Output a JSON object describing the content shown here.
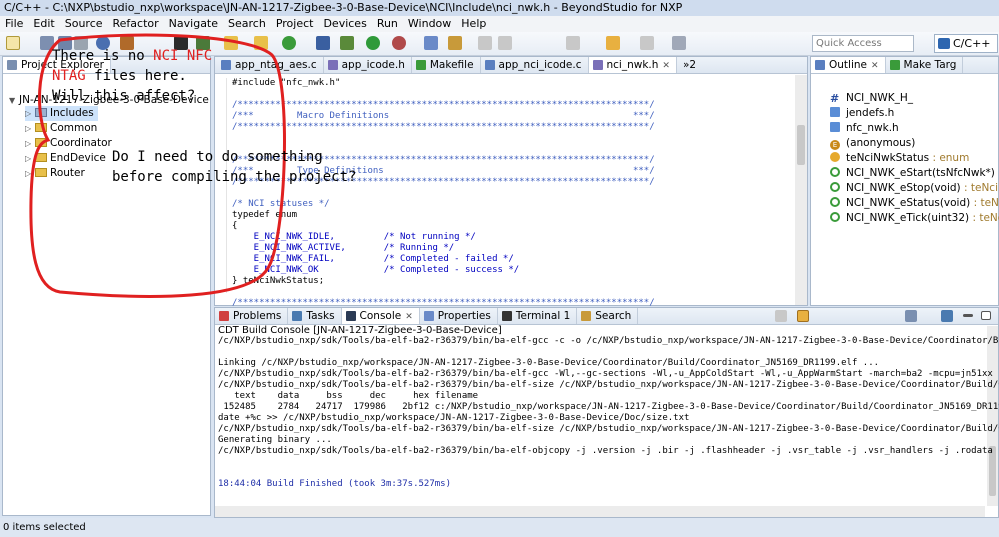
{
  "window_title": "C/C++ - C:\\NXP\\bstudio_nxp\\workspace\\JN-AN-1217-Zigbee-3-0-Base-Device\\NCI\\Include\\nci_nwk.h - BeyondStudio for NXP",
  "menu": [
    "File",
    "Edit",
    "Source",
    "Refactor",
    "Navigate",
    "Search",
    "Project",
    "Devices",
    "Run",
    "Window",
    "Help"
  ],
  "quick_access": {
    "placeholder": "Quick Access"
  },
  "perspective": "C/C++",
  "project_explorer": {
    "tab": "Project Explorer",
    "root": "JN-AN-1217-Zigbee-3-0-Base-Device",
    "items": [
      "Includes",
      "Common",
      "Coordinator",
      "EndDevice",
      "Router"
    ]
  },
  "editor": {
    "tabs": [
      "app_ntag_aes.c",
      "app_icode.h",
      "Makefile",
      "app_nci_icode.c",
      "nci_nwk.h"
    ],
    "overflow": "»2",
    "lines": [
      "#include \"nfc_nwk.h\"",
      "",
      "/****************************************************************************/",
      "/***        Macro Definitions                                             ***/",
      "/****************************************************************************/",
      "",
      "",
      "/****************************************************************************/",
      "/***        Type Definitions                                              ***/",
      "/****************************************************************************/",
      "",
      "/* NCI statuses */",
      "typedef enum",
      "{",
      "    E_NCI_NWK_IDLE,         /* Not running */",
      "    E_NCI_NWK_ACTIVE,       /* Running */",
      "    E_NCI_NWK_FAIL,         /* Completed - failed */",
      "    E_NCI_NWK_OK            /* Completed - success */",
      "} teNciNwkStatus;",
      "",
      "/****************************************************************************/",
      "/***        Exported Functions                                            ***/",
      "/****************************************************************************/"
    ]
  },
  "outline": {
    "tabs": [
      "Outline",
      "Make Targ"
    ],
    "items": [
      {
        "icon": "hash",
        "label": "NCI_NWK_H_",
        "type": ""
      },
      {
        "icon": "include",
        "label": "jendefs.h",
        "type": ""
      },
      {
        "icon": "include",
        "label": "nfc_nwk.h",
        "type": ""
      },
      {
        "icon": "enum",
        "label": "(anonymous)",
        "type": ""
      },
      {
        "icon": "enum-type",
        "label": "teNciNwkStatus",
        "type": " : enum"
      },
      {
        "icon": "function",
        "label": "NCI_NWK_eStart(tsNfcNwk*)",
        "type": " : teNci"
      },
      {
        "icon": "function",
        "label": "NCI_NWK_eStop(void)",
        "type": " : teNciNwkS"
      },
      {
        "icon": "function",
        "label": "NCI_NWK_eStatus(void)",
        "type": " : teNciNw"
      },
      {
        "icon": "function",
        "label": "NCI_NWK_eTick(uint32)",
        "type": " : teNciNw"
      }
    ]
  },
  "bottom_tabs": [
    "Problems",
    "Tasks",
    "Console",
    "Properties",
    "Terminal 1",
    "Search"
  ],
  "console": {
    "title": "CDT Build Console [JN-AN-1217-Zigbee-3-0-Base-Device]",
    "lines": [
      "/c/NXP/bstudio_nxp/sdk/Tools/ba-elf-ba2-r36379/bin/ba-elf-gcc -c -o /c/NXP/bstudio_nxp/workspace/JN-AN-1217-Zigbee-3-0-Base-Device/Coordinator/Build/b",
      "",
      "Linking /c/NXP/bstudio_nxp/workspace/JN-AN-1217-Zigbee-3-0-Base-Device/Coordinator/Build/Coordinator_JN5169_DR1199.elf ...",
      "/c/NXP/bstudio_nxp/sdk/Tools/ba-elf-ba2-r36379/bin/ba-elf-gcc -Wl,--gc-sections -Wl,-u_AppColdStart -Wl,-u_AppWarmStart -march=ba2 -mcpu=jn51xx -mredu",
      "/c/NXP/bstudio_nxp/sdk/Tools/ba-elf-ba2-r36379/bin/ba-elf-size /c/NXP/bstudio_nxp/workspace/JN-AN-1217-Zigbee-3-0-Base-Device/Coordinator/Build/Coordi",
      "   text    data     bss     dec     hex filename",
      " 152485    2784   24717  179986   2bf12 c:/NXP/bstudio_nxp/workspace/JN-AN-1217-Zigbee-3-0-Base-Device/Coordinator/Build/Coordinator_JN5169_DR1199.elf",
      "date +%c >> /c/NXP/bstudio_nxp/workspace/JN-AN-1217-Zigbee-3-0-Base-Device/Doc/size.txt",
      "/c/NXP/bstudio_nxp/sdk/Tools/ba-elf-ba2-r36379/bin/ba-elf-size /c/NXP/bstudio_nxp/workspace/JN-AN-1217-Zigbee-3-0-Base-Device/Coordinator/Build/Coordi",
      "Generating binary ...",
      "/c/NXP/bstudio_nxp/sdk/Tools/ba-elf-ba2-r36379/bin/ba-elf-objcopy -j .version -j .bir -j .flashheader -j .vsr_table -j .vsr_handlers -j .rodata -j .te",
      "",
      ""
    ],
    "finished": "18:44:04 Build Finished (took 3m:37s.527ms)"
  },
  "status": "0 items selected",
  "annotations": {
    "note1_line1_a": "There is no ",
    "note1_line1_b": "NCI NFC",
    "note1_line2_a": "NTAG",
    "note1_line2_b": " files here.",
    "note1_line3": "Will this affect?",
    "note2_line1": "Do I need to do something",
    "note2_line2": "before compiling the project?",
    "color": "#e02020"
  },
  "colors": {
    "accent": "#2e66b0",
    "comment": "#3f5fbf",
    "keyword": "#7f0055",
    "enum_const": "#0000c0",
    "finish": "#1f2fa8"
  }
}
